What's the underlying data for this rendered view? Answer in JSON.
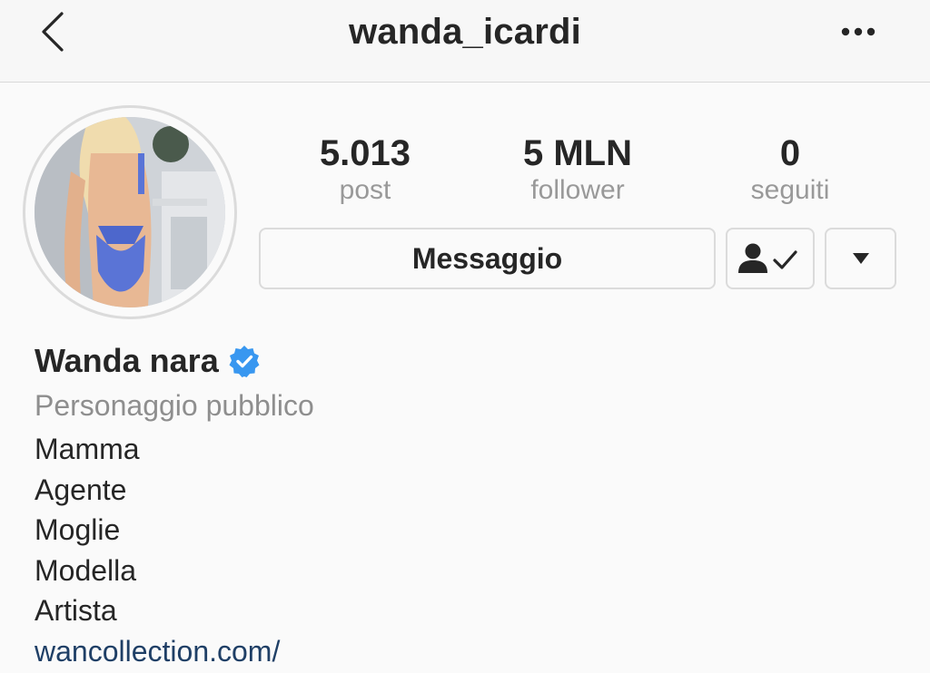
{
  "header": {
    "username": "wanda_icardi",
    "back_icon": "chevron-left-icon",
    "more_icon": "more-dots-icon"
  },
  "profile": {
    "avatar": "profile-photo",
    "stats": [
      {
        "value": "5.013",
        "label": "post"
      },
      {
        "value": "5 MLN",
        "label": "follower"
      },
      {
        "value": "0",
        "label": "seguiti"
      }
    ],
    "buttons": {
      "message_label": "Messaggio",
      "following_icon": "person-check-icon",
      "dropdown_icon": "caret-down-icon"
    },
    "name": "Wanda nara",
    "verified": true,
    "category": "Personaggio pubblico",
    "bio_lines": [
      "Mamma",
      "Agente",
      "Moglie",
      "Modella",
      "Artista"
    ],
    "link": "wancollection.com/"
  },
  "colors": {
    "text": "#262626",
    "secondary": "#8e8e8e",
    "verified_blue": "#3897f0",
    "link": "#1f3f66",
    "border": "#dbdbdb"
  }
}
